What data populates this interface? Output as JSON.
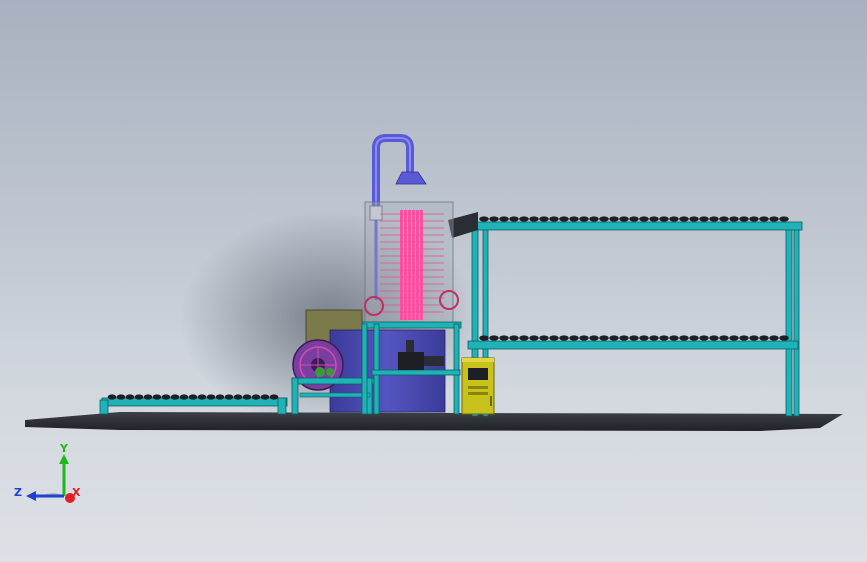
{
  "viewport": {
    "background_top": "#a7b1bf",
    "background_bottom": "#dde1e6"
  },
  "model": {
    "frame_color": "#1fb3b8",
    "floor_color": "#2f3237",
    "duct_color": "#5a5ad6",
    "heater_color": "#ff4fa3",
    "tank_color": "#4b4bb0",
    "cabinet_color": "#c9c21a",
    "cabinet_screen_text": "",
    "roller_color": "#1c1f24"
  },
  "triad": {
    "x_label": "X",
    "y_label": "Y",
    "z_label": "Z",
    "x_color": "#e02020",
    "y_color": "#1cb81c",
    "z_color": "#2040d0"
  }
}
